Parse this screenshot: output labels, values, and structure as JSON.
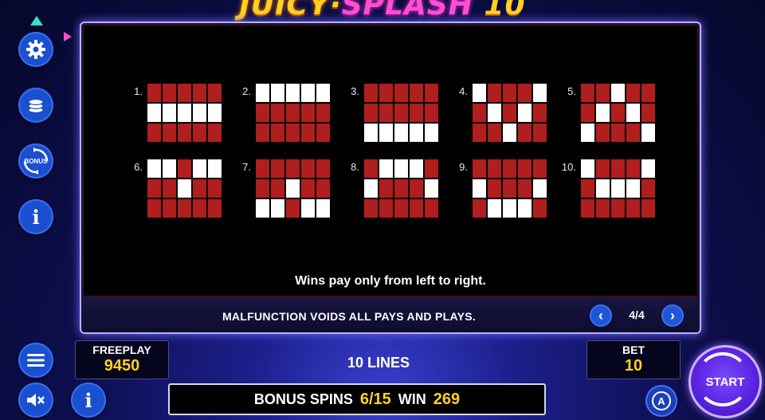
{
  "game_logo": {
    "part1": "JUICY",
    "part2": "SPLASH",
    "part3": "10"
  },
  "paylines": [
    {
      "number": "1.",
      "pattern": [
        [
          0,
          0,
          0,
          0,
          0
        ],
        [
          1,
          1,
          1,
          1,
          1
        ],
        [
          0,
          0,
          0,
          0,
          0
        ]
      ]
    },
    {
      "number": "2.",
      "pattern": [
        [
          1,
          1,
          1,
          1,
          1
        ],
        [
          0,
          0,
          0,
          0,
          0
        ],
        [
          0,
          0,
          0,
          0,
          0
        ]
      ]
    },
    {
      "number": "3.",
      "pattern": [
        [
          0,
          0,
          0,
          0,
          0
        ],
        [
          0,
          0,
          0,
          0,
          0
        ],
        [
          1,
          1,
          1,
          1,
          1
        ]
      ]
    },
    {
      "number": "4.",
      "pattern": [
        [
          1,
          0,
          0,
          0,
          1
        ],
        [
          0,
          1,
          0,
          1,
          0
        ],
        [
          0,
          0,
          1,
          0,
          0
        ]
      ]
    },
    {
      "number": "5.",
      "pattern": [
        [
          0,
          0,
          1,
          0,
          0
        ],
        [
          0,
          1,
          0,
          1,
          0
        ],
        [
          1,
          0,
          0,
          0,
          1
        ]
      ]
    },
    {
      "number": "6.",
      "pattern": [
        [
          1,
          1,
          0,
          1,
          1
        ],
        [
          0,
          0,
          1,
          0,
          0
        ],
        [
          0,
          0,
          0,
          0,
          0
        ]
      ]
    },
    {
      "number": "7.",
      "pattern": [
        [
          0,
          0,
          0,
          0,
          0
        ],
        [
          0,
          0,
          1,
          0,
          0
        ],
        [
          1,
          1,
          0,
          1,
          1
        ]
      ]
    },
    {
      "number": "8.",
      "pattern": [
        [
          0,
          1,
          1,
          1,
          0
        ],
        [
          1,
          0,
          0,
          0,
          1
        ],
        [
          0,
          0,
          0,
          0,
          0
        ]
      ]
    },
    {
      "number": "9.",
      "pattern": [
        [
          0,
          0,
          0,
          0,
          0
        ],
        [
          1,
          0,
          0,
          0,
          1
        ],
        [
          0,
          1,
          1,
          1,
          0
        ]
      ]
    },
    {
      "number": "10.",
      "pattern": [
        [
          1,
          0,
          0,
          0,
          1
        ],
        [
          0,
          1,
          1,
          1,
          0
        ],
        [
          0,
          0,
          0,
          0,
          0
        ]
      ]
    }
  ],
  "wins_text": "Wins pay only from left to right.",
  "malfunction_text": "MALFUNCTION VOIDS ALL PAYS AND PLAYS.",
  "pager": {
    "prev": "‹",
    "next": "›",
    "page": "4/4"
  },
  "side_menu": {
    "bonus_label": "BONUS",
    "info_glyph": "i"
  },
  "freeplay": {
    "label": "FREEPLAY",
    "value": "9450"
  },
  "lines": {
    "label": "10 LINES"
  },
  "bet": {
    "label": "BET",
    "value": "10"
  },
  "bonus_bar": {
    "spins_label": "BONUS SPINS",
    "spins_value": "6/15",
    "win_label": "WIN",
    "win_value": "269"
  },
  "start_label": "START",
  "auto_label": "A",
  "colors": {
    "cell_red": "#b01e1e",
    "cell_white": "#ffffff",
    "accent_yellow": "#ffd21f",
    "button_blue": "#1a4fd0",
    "start_purple": "#5a22e0"
  }
}
